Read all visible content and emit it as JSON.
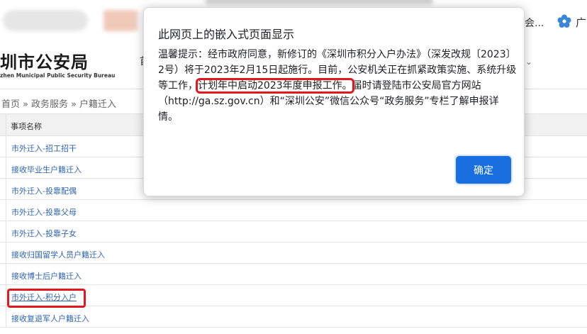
{
  "topbar": {
    "right_text": "会...",
    "right_text2": "广"
  },
  "header": {
    "logo_cn": "圳市公安局",
    "logo_en": "zhen Municipal Public Security Bureau",
    "nav_first": "首"
  },
  "breadcrumb": {
    "home": "首页",
    "sep": "»",
    "section": "政务服务",
    "current": "户籍迁入"
  },
  "table": {
    "header": "事项名称",
    "rows": [
      "市外迁入-招工招干",
      "接收毕业生户籍迁入",
      "市外迁入-投靠配偶",
      "市外迁入-投靠父母",
      "市外迁入-投靠子女",
      "接收归国留学人员户籍迁入",
      "接收博士后户籍迁入",
      "市外迁入-积分入户",
      "接收复退军人户籍迁入"
    ]
  },
  "dialog": {
    "title": "此网页上的嵌入式页面显示",
    "body_before": "温馨提示：经市政府同意，新修订的《深圳市积分入户办法》（深发改规〔2023〕2号）将于2023年2月15日起施行。目前，公安机关正在抓紧政策实施、系统升级等工作，",
    "body_highlight": "计划年中启动2023年度申报工作。",
    "body_after": "届时请登陆市公安局官方网站（http://ga.sz.gov.cn）和“深圳公安”微信公众号“政务服务”专栏了解申报详情。",
    "ok_label": "确定"
  },
  "colors": {
    "accent": "#1a6fe0",
    "link": "#2f64ad",
    "highlight_border": "#e0191d"
  }
}
